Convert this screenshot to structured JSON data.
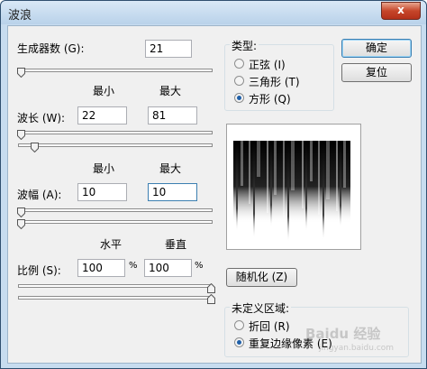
{
  "window": {
    "title": "波浪",
    "close_label": "x"
  },
  "generators": {
    "label": "生成器数 (G):",
    "value": "21",
    "slider_value": 21
  },
  "column_headers": {
    "min": "最小",
    "max": "最大"
  },
  "wavelength": {
    "label": "波长 (W):",
    "min": "22",
    "max": "81"
  },
  "amplitude": {
    "label": "波幅 (A):",
    "min": "10",
    "max": "10"
  },
  "scale_headers": {
    "horizontal": "水平",
    "vertical": "垂直"
  },
  "scale": {
    "label": "比例 (S):",
    "horizontal": "100",
    "vertical": "100",
    "unit": "%"
  },
  "type_group": {
    "label": "类型:",
    "options": [
      {
        "label": "正弦 (I)",
        "selected": false
      },
      {
        "label": "三角形 (T)",
        "selected": false
      },
      {
        "label": "方形 (Q)",
        "selected": true
      }
    ]
  },
  "buttons": {
    "ok": "确定",
    "reset": "复位",
    "randomize": "随机化 (Z)"
  },
  "undefined_group": {
    "label": "未定义区域:",
    "options": [
      {
        "label": "折回 (R)",
        "selected": false
      },
      {
        "label": "重复边缘像素 (E)",
        "selected": true
      }
    ]
  },
  "watermark": {
    "text": "Baidu 经验",
    "url": "jingyan.baidu.com"
  }
}
